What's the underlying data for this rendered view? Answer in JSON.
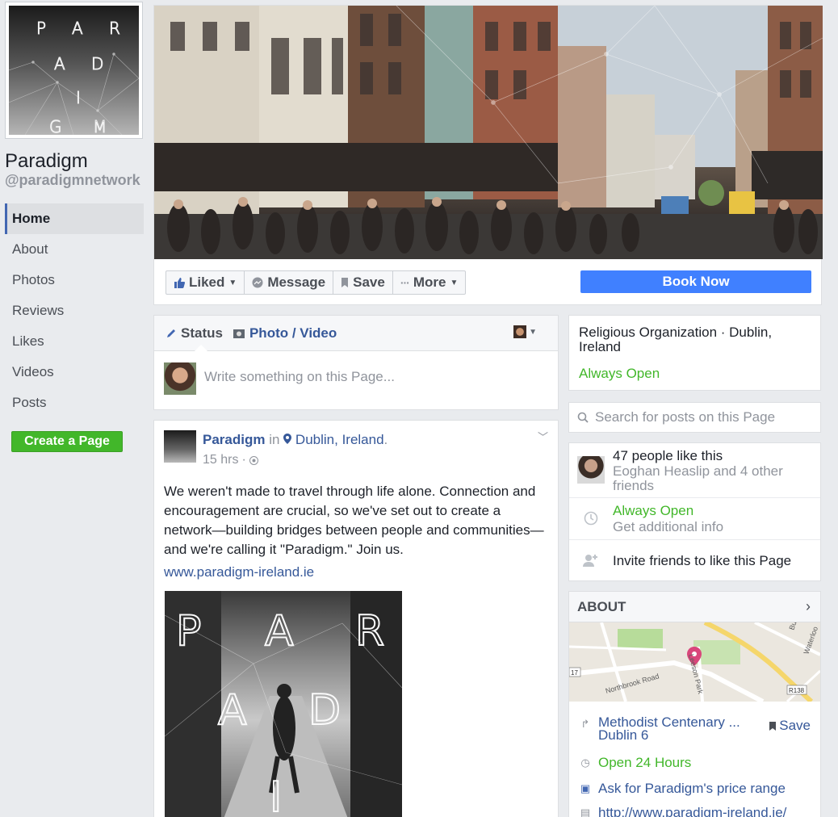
{
  "page": {
    "name": "Paradigm",
    "handle": "@paradigmnetwork",
    "profile_letters": [
      "P",
      "A",
      "R",
      "A",
      "D",
      "I",
      "G",
      "M"
    ]
  },
  "nav": {
    "items": [
      {
        "label": "Home",
        "active": true
      },
      {
        "label": "About"
      },
      {
        "label": "Photos"
      },
      {
        "label": "Reviews"
      },
      {
        "label": "Likes"
      },
      {
        "label": "Videos"
      },
      {
        "label": "Posts"
      }
    ],
    "create_page": "Create a Page"
  },
  "actions": {
    "liked": "Liked",
    "message": "Message",
    "save": "Save",
    "more": "More",
    "book_now": "Book Now"
  },
  "composer": {
    "status_tab": "Status",
    "photo_tab": "Photo / Video",
    "placeholder": "Write something on this Page..."
  },
  "post": {
    "author": "Paradigm",
    "in_word": "in",
    "location": "Dublin, Ireland",
    "time": "15 hrs",
    "text": "We weren't made to travel through life alone. Connection and encouragement are crucial, so we've set out to create a network—building bridges between people and communities—and we're calling it \"Paradigm.\" Join us.",
    "link": "www.paradigm-ireland.ie",
    "image_letters": [
      "P",
      "A",
      "R",
      "A",
      "D",
      "I"
    ]
  },
  "info": {
    "category": "Religious Organization · Dublin, Ireland",
    "open_status": "Always Open"
  },
  "search": {
    "placeholder": "Search for posts on this Page"
  },
  "likes": {
    "count_text": "47 people like this",
    "friends_text": "Eoghan Heaslip and 4 other friends",
    "hours_status": "Always Open",
    "hours_more": "Get additional info",
    "invite": "Invite friends to like this Page"
  },
  "about": {
    "title": "ABOUT",
    "address_line1": "Methodist Centenary ...",
    "address_line2": "Dublin 6",
    "save": "Save",
    "hours": "Open 24 Hours",
    "price_range": "Ask for Paradigm's price range",
    "website": "http://www.paradigm-ireland.ie/",
    "map_labels": {
      "road1": "Northbrook Road",
      "road2": "Leeson Park",
      "road3": "Waterloo",
      "road4": "Bu",
      "route": "R138",
      "num": "17"
    }
  },
  "colors": {
    "brand_blue": "#4267b2",
    "link_blue": "#365899",
    "cta_blue": "#4080ff",
    "green": "#42b72a",
    "background": "#e9ebee"
  }
}
